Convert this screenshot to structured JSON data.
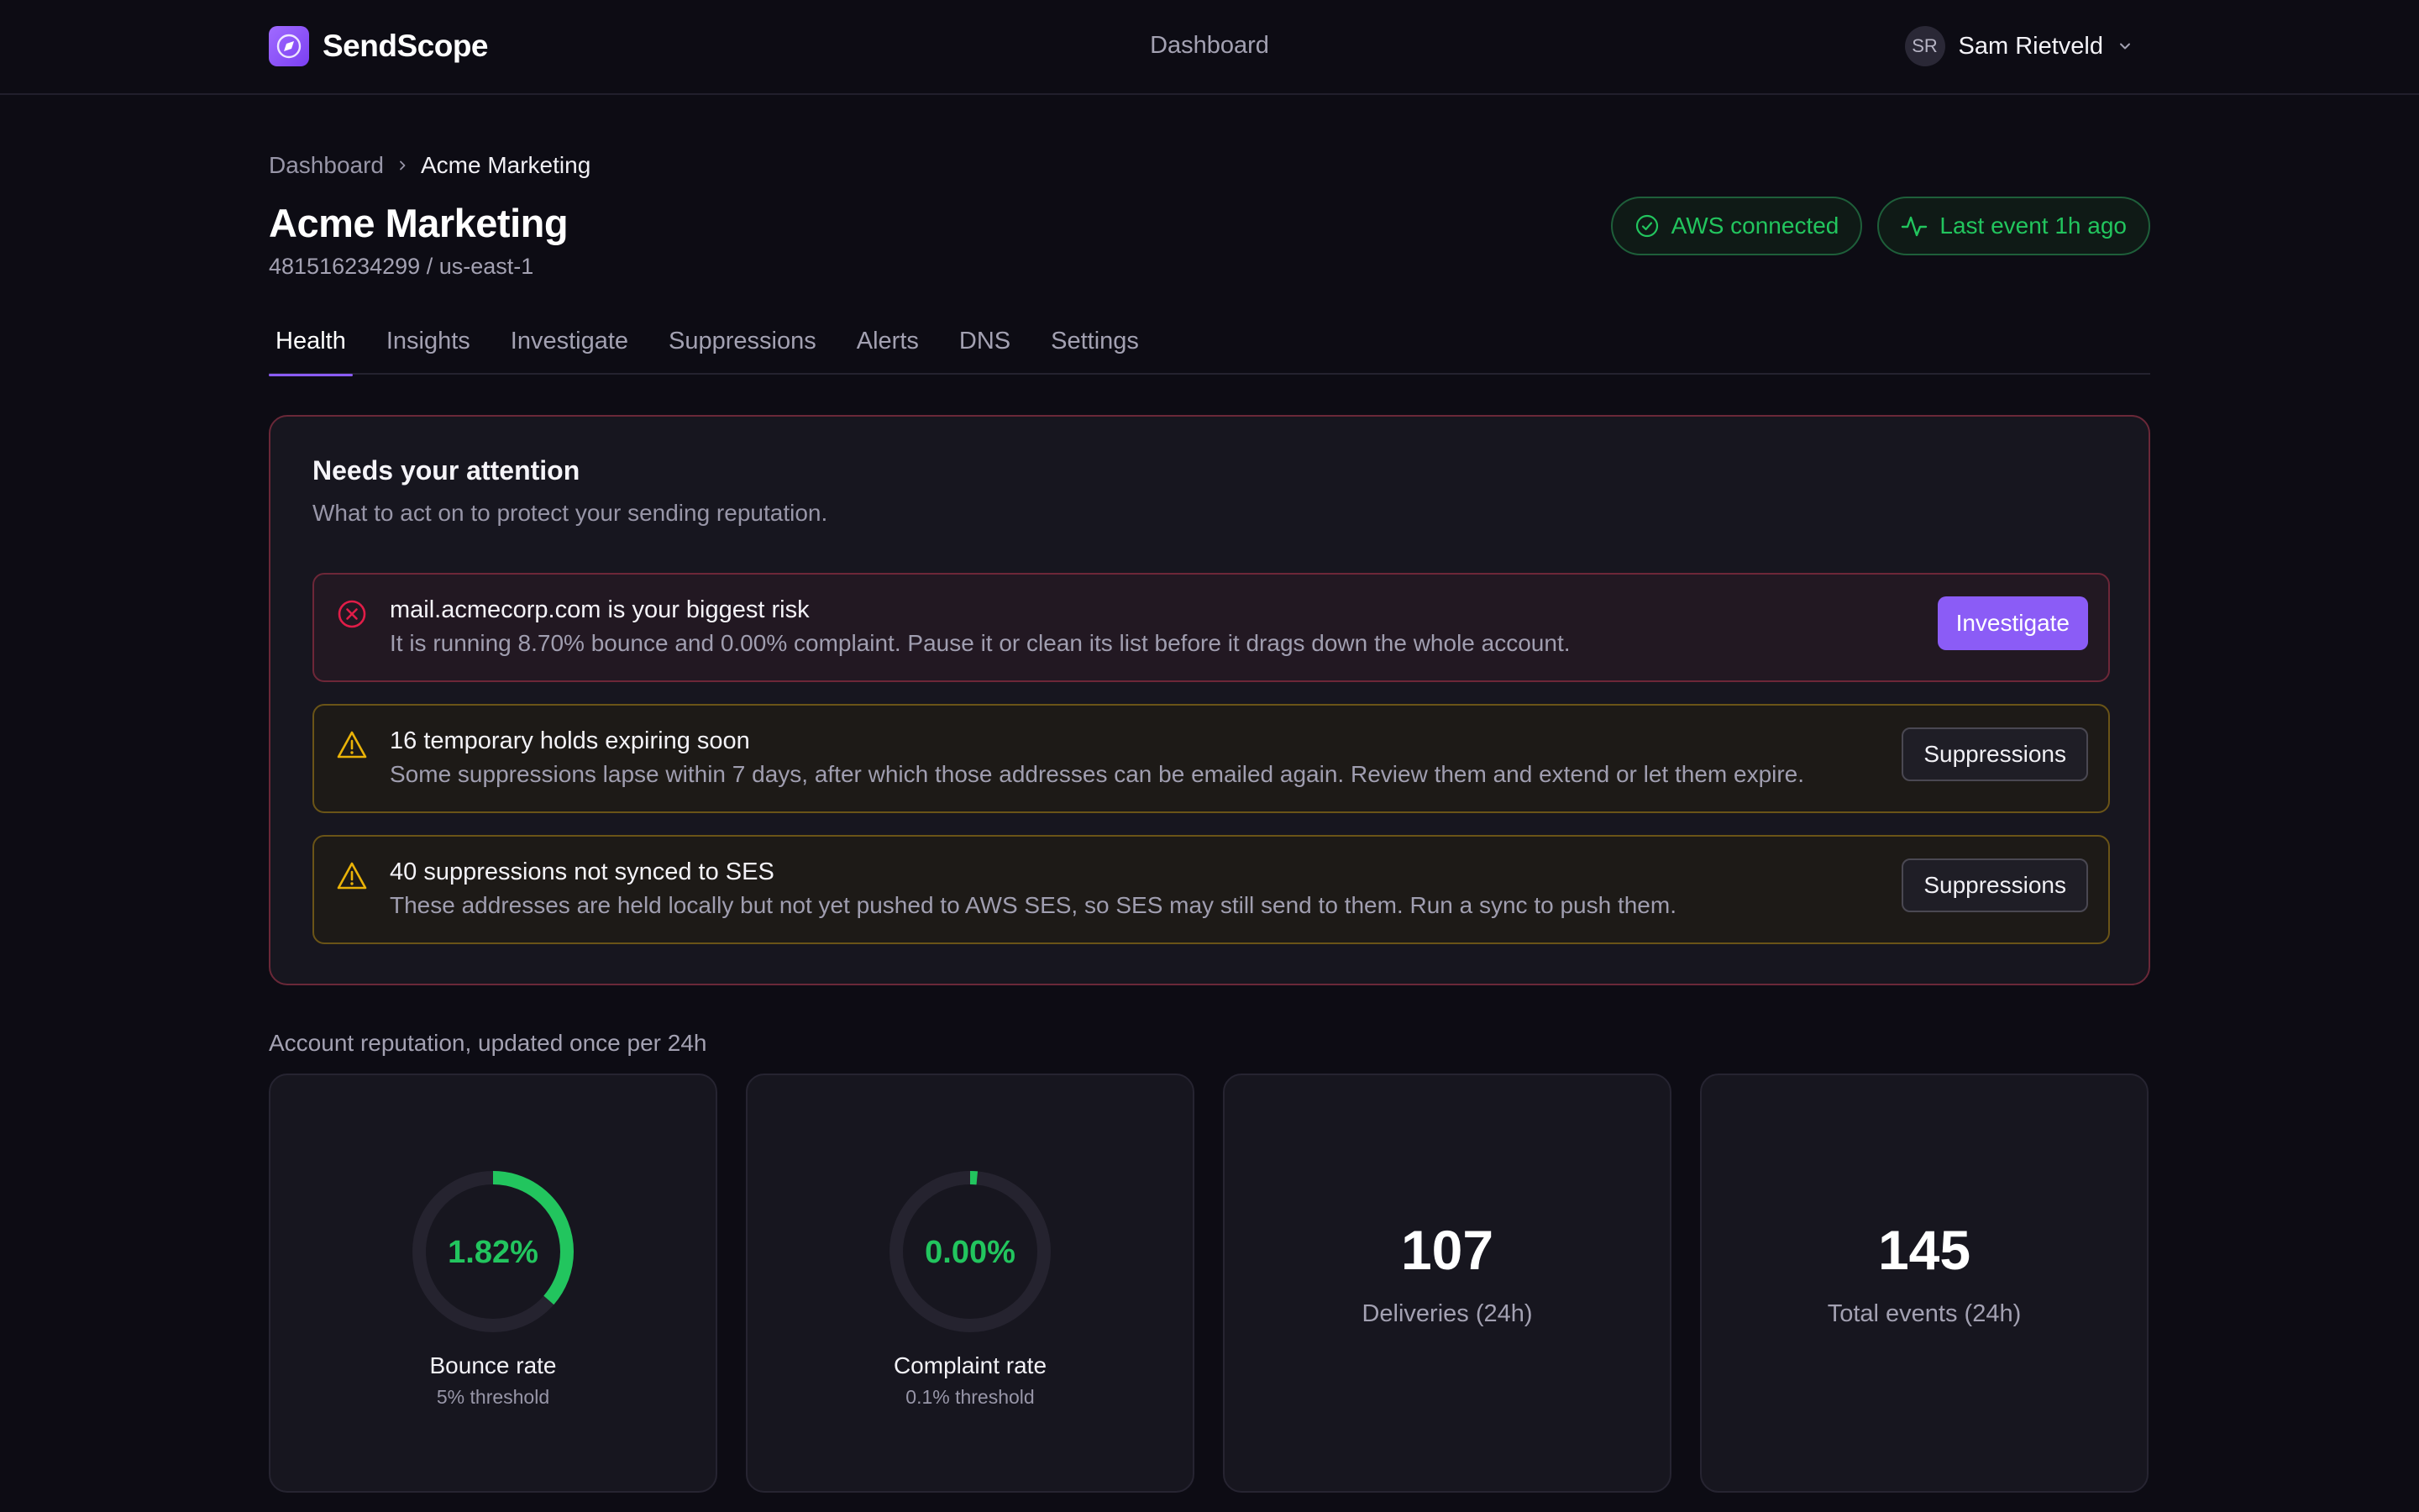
{
  "brand": {
    "name": "SendScope"
  },
  "nav": {
    "center": "Dashboard"
  },
  "user": {
    "initials": "SR",
    "name": "Sam Rietveld"
  },
  "breadcrumb": {
    "root": "Dashboard",
    "current": "Acme Marketing"
  },
  "page": {
    "title": "Acme Marketing",
    "subtitle": "481516234299 / us-east-1"
  },
  "status": {
    "aws": "AWS connected",
    "last_event": "Last event 1h ago"
  },
  "tabs": [
    "Health",
    "Insights",
    "Investigate",
    "Suppressions",
    "Alerts",
    "DNS",
    "Settings"
  ],
  "attention": {
    "title": "Needs your attention",
    "subtitle": "What to act on to protect your sending reputation.",
    "alerts": [
      {
        "title": "mail.acmecorp.com is your biggest risk",
        "desc": "It is running 8.70% bounce and 0.00% complaint. Pause it or clean its list before it drags down the whole account.",
        "action": "Investigate"
      },
      {
        "title": "16 temporary holds expiring soon",
        "desc": "Some suppressions lapse within 7 days, after which those addresses can be emailed again. Review them and extend or let them expire.",
        "action": "Suppressions"
      },
      {
        "title": "40 suppressions not synced to SES",
        "desc": "These addresses are held locally but not yet pushed to AWS SES, so SES may still send to them. Run a sync to push them.",
        "action": "Suppressions"
      }
    ]
  },
  "reputation": {
    "label": "Account reputation, updated once per 24h",
    "bounce": {
      "value": "1.82%",
      "label": "Bounce rate",
      "threshold": "5% threshold",
      "fraction": 0.364
    },
    "complaint": {
      "value": "0.00%",
      "label": "Complaint rate",
      "threshold": "0.1% threshold",
      "fraction": 0.015
    },
    "deliveries": {
      "value": "107",
      "label": "Deliveries (24h)"
    },
    "events": {
      "value": "145",
      "label": "Total events (24h)"
    }
  },
  "colors": {
    "accent": "#8b5cf6",
    "success": "#22c55e",
    "danger": "#e11d48",
    "warning": "#eab308"
  }
}
